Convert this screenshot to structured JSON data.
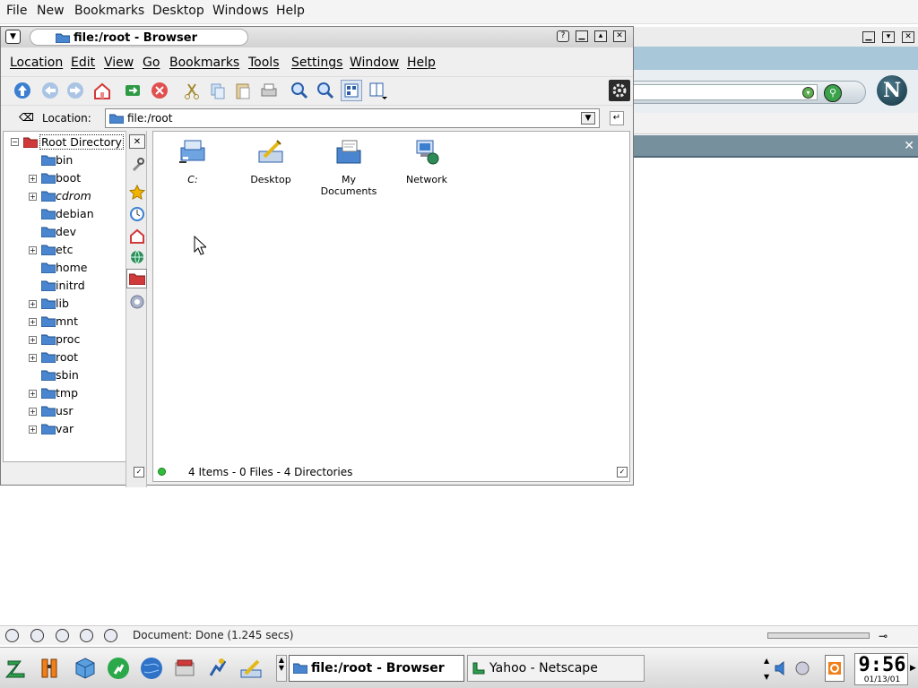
{
  "netscape": {
    "menu": [
      "File",
      "New",
      "Bookmarks",
      "Desktop",
      "Windows",
      "Help"
    ],
    "status_text": "Document: Done (1.245 secs)",
    "logo_letter": "N"
  },
  "browser": {
    "title": "file:/root - Browser",
    "menu": [
      "Location",
      "Edit",
      "View",
      "Go",
      "Bookmarks",
      "Tools",
      "Settings",
      "Window",
      "Help"
    ],
    "location_label": "Location:",
    "location_value": "file:/root",
    "tree": {
      "root": "Root Directory",
      "items": [
        {
          "label": "bin",
          "expandable": false
        },
        {
          "label": "boot",
          "expandable": true
        },
        {
          "label": "cdrom",
          "expandable": true,
          "italic": true
        },
        {
          "label": "debian",
          "expandable": false
        },
        {
          "label": "dev",
          "expandable": false
        },
        {
          "label": "etc",
          "expandable": true
        },
        {
          "label": "home",
          "expandable": false
        },
        {
          "label": "initrd",
          "expandable": false
        },
        {
          "label": "lib",
          "expandable": true
        },
        {
          "label": "mnt",
          "expandable": true
        },
        {
          "label": "proc",
          "expandable": true
        },
        {
          "label": "root",
          "expandable": true
        },
        {
          "label": "sbin",
          "expandable": false
        },
        {
          "label": "tmp",
          "expandable": true
        },
        {
          "label": "usr",
          "expandable": true
        },
        {
          "label": "var",
          "expandable": true
        }
      ]
    },
    "files": [
      {
        "label": "C:",
        "icon": "drive-icon"
      },
      {
        "label": "Desktop",
        "icon": "desktop-icon"
      },
      {
        "label": "My Documents",
        "icon": "documents-icon"
      },
      {
        "label": "Network",
        "icon": "network-icon"
      }
    ],
    "status": "4 Items - 0 Files - 4 Directories"
  },
  "taskbar": {
    "tasks": [
      {
        "label": "file:/root - Browser",
        "active": true
      },
      {
        "label": "Yahoo - Netscape",
        "active": false
      }
    ],
    "clock_time": "9:56",
    "clock_date": "01/13/01"
  },
  "colors": {
    "folder_blue": "#4a86cf",
    "folder_red": "#d13a3a",
    "accent": "#76909e"
  }
}
